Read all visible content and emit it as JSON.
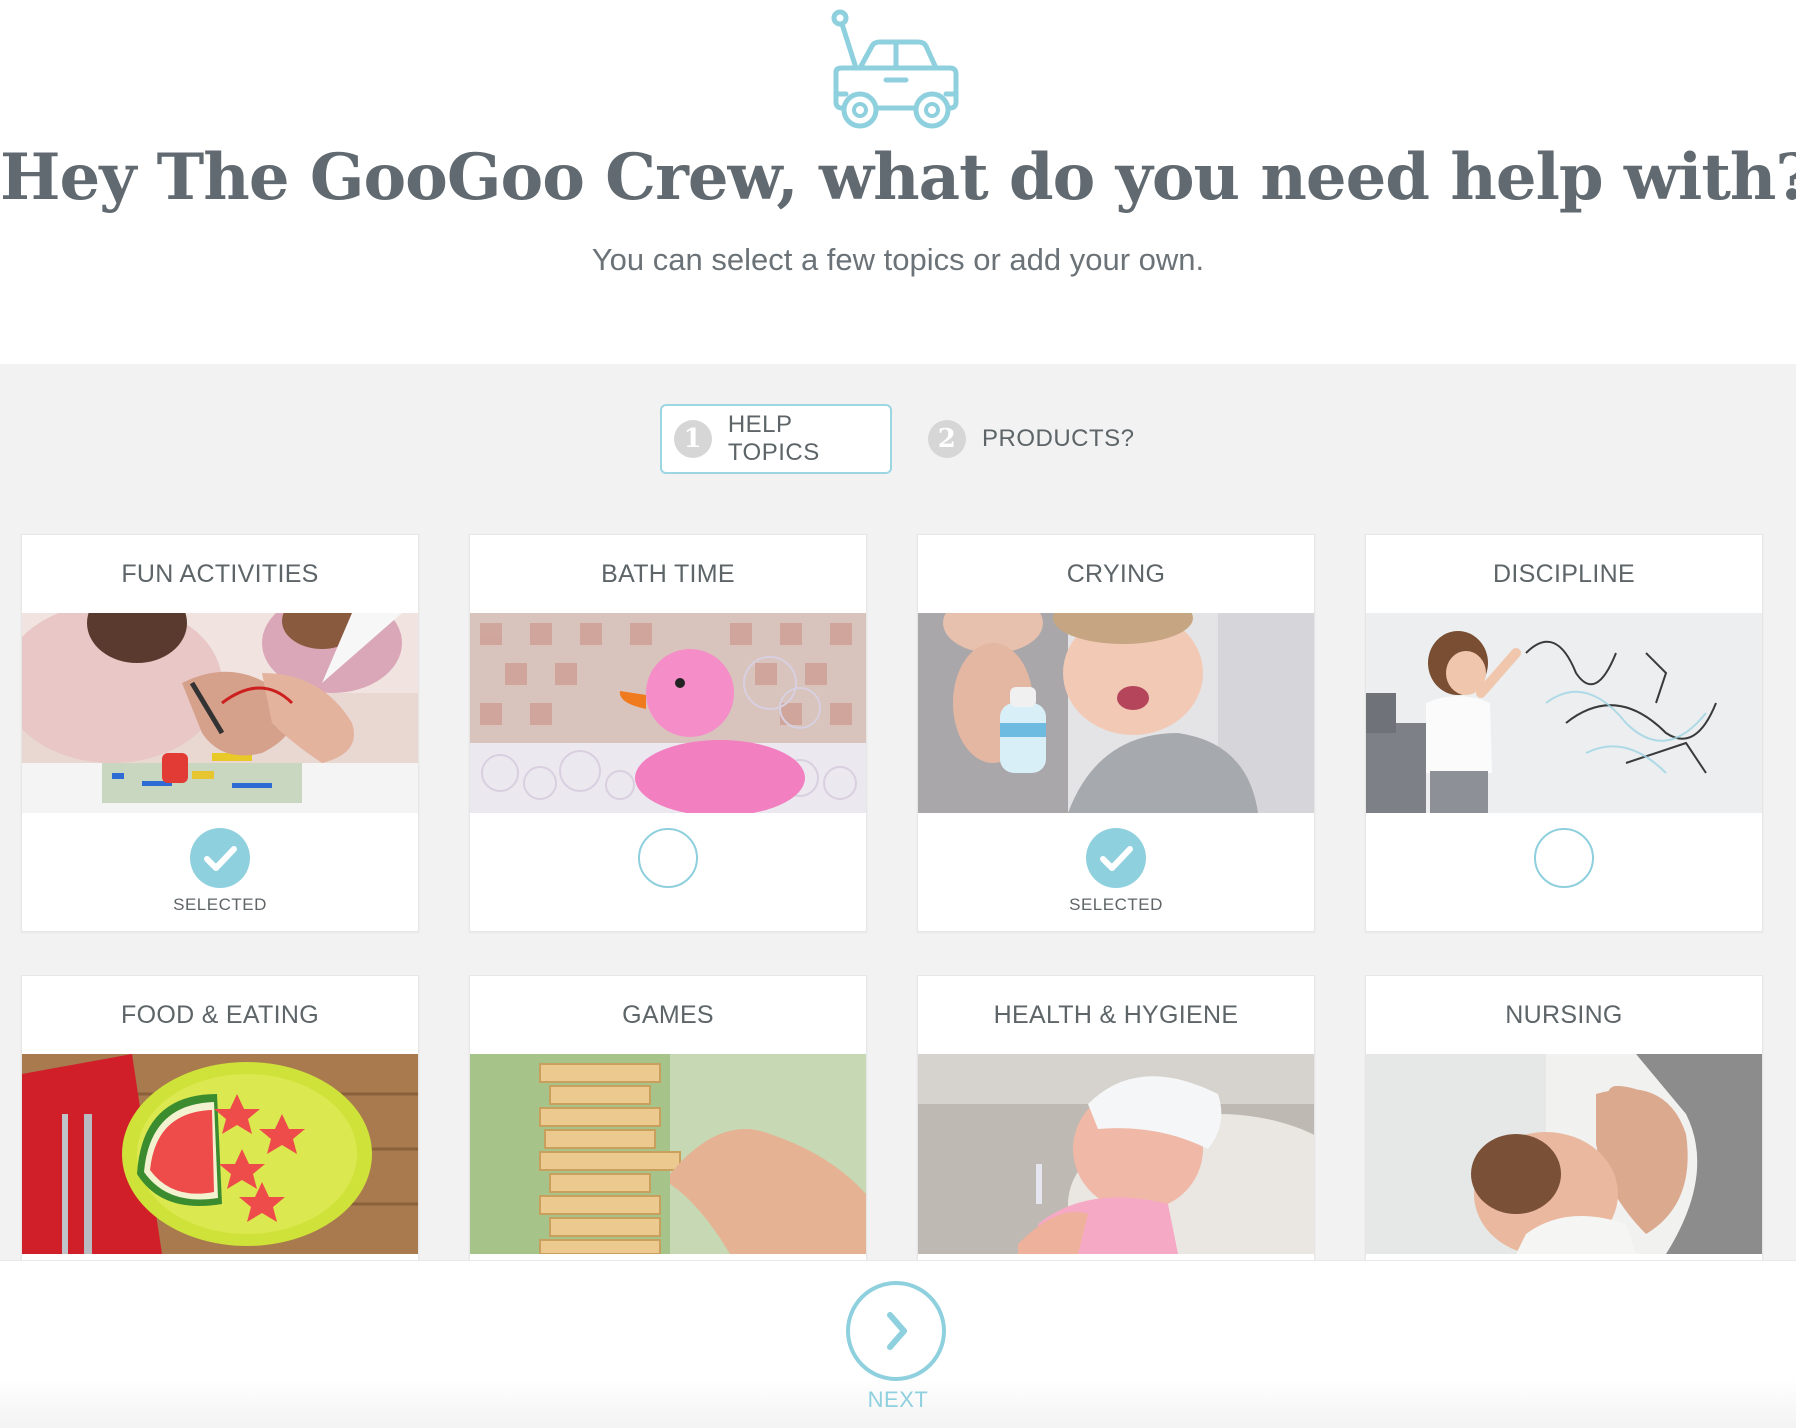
{
  "header": {
    "logo_icon": "toy-car-icon",
    "title": "Hey The GooGoo Crew, what do you need help with?",
    "subtitle": "You can select a few topics or add your own."
  },
  "steps": [
    {
      "number": "1",
      "label": "HELP TOPICS",
      "active": true
    },
    {
      "number": "2",
      "label": "PRODUCTS?",
      "active": false
    }
  ],
  "topics": [
    {
      "title": "FUN ACTIVITIES",
      "image": "kids-building-circuit-photo",
      "selected": true,
      "selected_label": "SELECTED"
    },
    {
      "title": "BATH TIME",
      "image": "pink-rubber-duck-photo",
      "selected": false,
      "selected_label": ""
    },
    {
      "title": "CRYING",
      "image": "crying-baby-with-bottle-photo",
      "selected": true,
      "selected_label": "SELECTED"
    },
    {
      "title": "DISCIPLINE",
      "image": "toddler-drawing-on-wall-photo",
      "selected": false,
      "selected_label": ""
    },
    {
      "title": "FOOD & EATING",
      "image": "watermelon-stars-plate-photo",
      "selected": null
    },
    {
      "title": "GAMES",
      "image": "wooden-block-tower-photo",
      "selected": null
    },
    {
      "title": "HEALTH & HYGIENE",
      "image": "sick-child-with-towel-photo",
      "selected": null
    },
    {
      "title": "NURSING",
      "image": "breastfeeding-baby-photo",
      "selected": null
    }
  ],
  "footer": {
    "next_icon": "chevron-right-icon",
    "next_label": "NEXT"
  },
  "colors": {
    "accent": "#8ed0de",
    "title_text": "#616a70",
    "body_text": "#5d6569",
    "background_grey": "#f2f2f2"
  }
}
